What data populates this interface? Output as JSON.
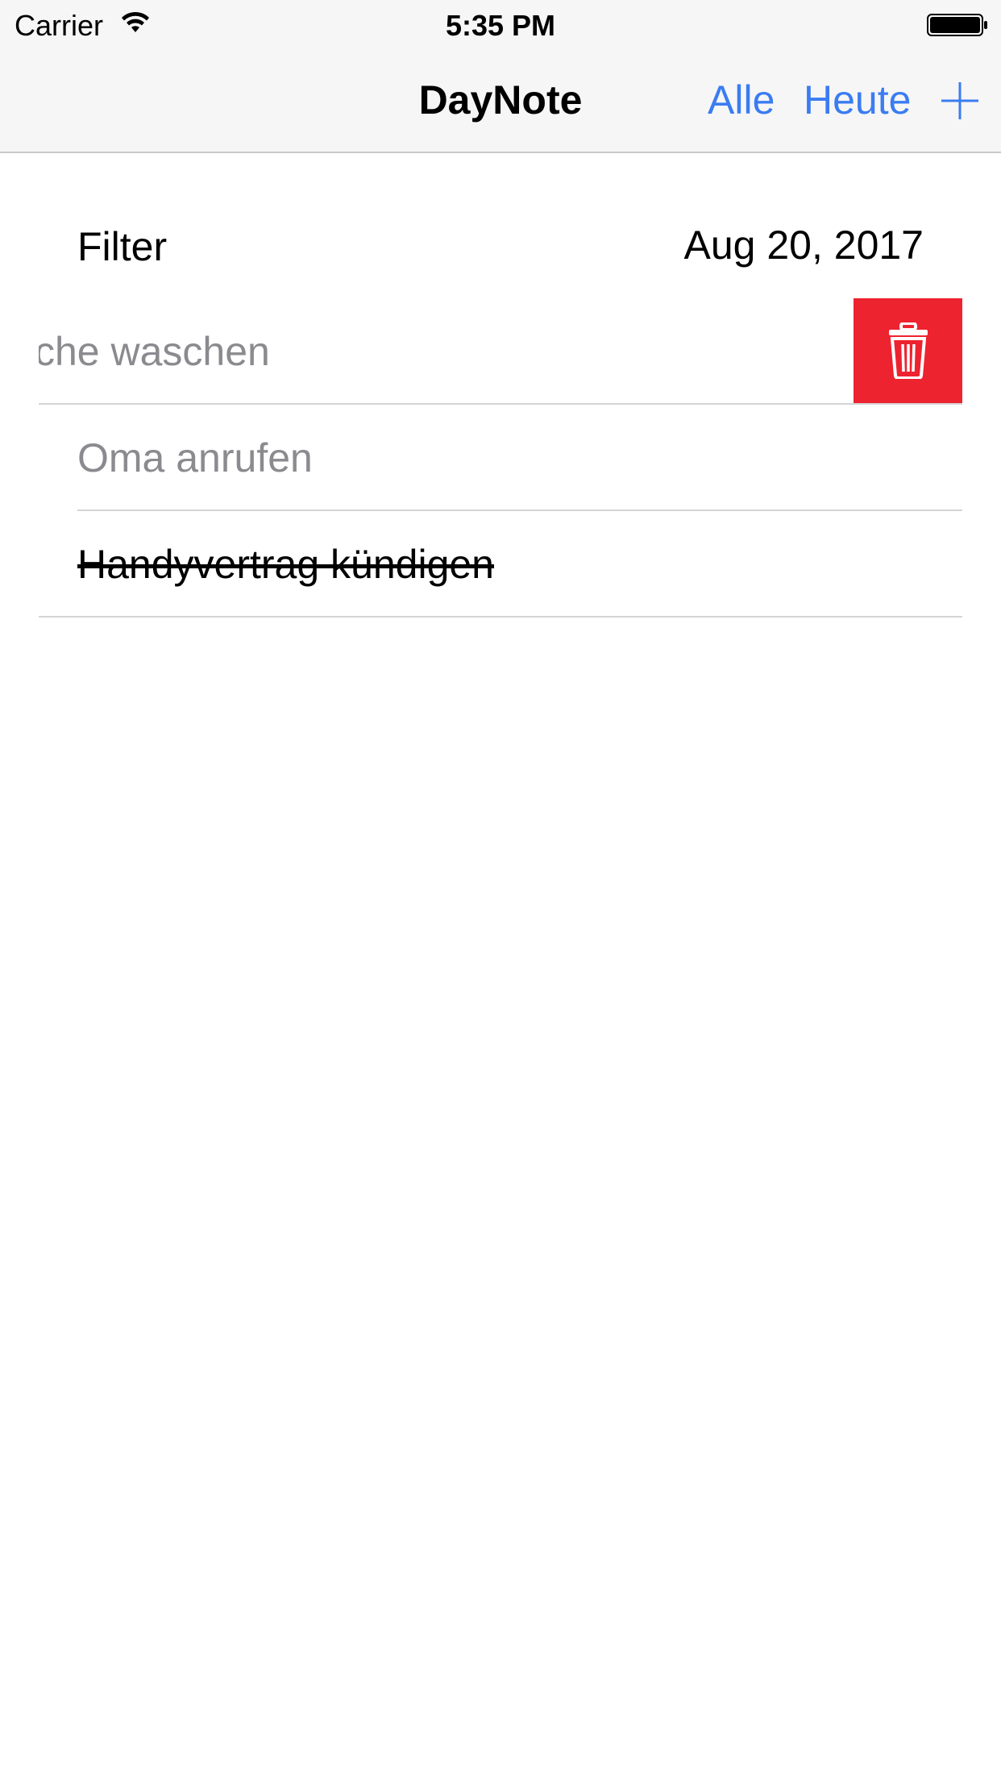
{
  "status_bar": {
    "carrier": "Carrier",
    "time": "5:35 PM",
    "wifi_icon": "wifi-icon",
    "battery_icon": "battery-icon"
  },
  "nav_bar": {
    "title": "DayNote",
    "buttons": [
      {
        "label": "Alle"
      },
      {
        "label": "Heute"
      }
    ],
    "add_icon": "plus-icon",
    "accent_color": "#3a7cf2"
  },
  "filter": {
    "label": "Filter",
    "date": "Aug 20, 2017"
  },
  "notes": [
    {
      "text": "Wäsche waschen",
      "visible_text": "sche waschen",
      "done": false,
      "swiped_open": true
    },
    {
      "text": "Oma anrufen",
      "done": false,
      "swiped_open": false
    },
    {
      "text": "Handyvertrag kündigen",
      "done": true,
      "swiped_open": false
    }
  ],
  "delete_action": {
    "icon": "trash-icon",
    "color": "#ee2330"
  }
}
